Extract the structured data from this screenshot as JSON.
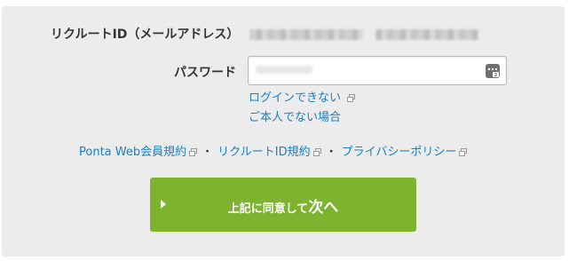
{
  "form": {
    "id_label": "リクルートID（メールアドレス）",
    "password_label": "パスワード",
    "password_value": "••••••••"
  },
  "links": {
    "login_trouble": "ログインできない",
    "not_me": "ご本人でない場合"
  },
  "terms": {
    "ponta": "Ponta Web会員規約",
    "recruit_id": "リクルートID規約",
    "privacy": "プライバシーポリシー",
    "separator": "・"
  },
  "cta": {
    "label_prefix": "上記に同意して",
    "label_emphasis": "次へ"
  },
  "colors": {
    "link": "#1a7fc1",
    "button": "#7db32f",
    "panel": "#ececec"
  },
  "icons": {
    "external_link": "external-window-icon",
    "keychain": "password-keychain-icon",
    "button_arrow": "play-arrow-icon"
  }
}
